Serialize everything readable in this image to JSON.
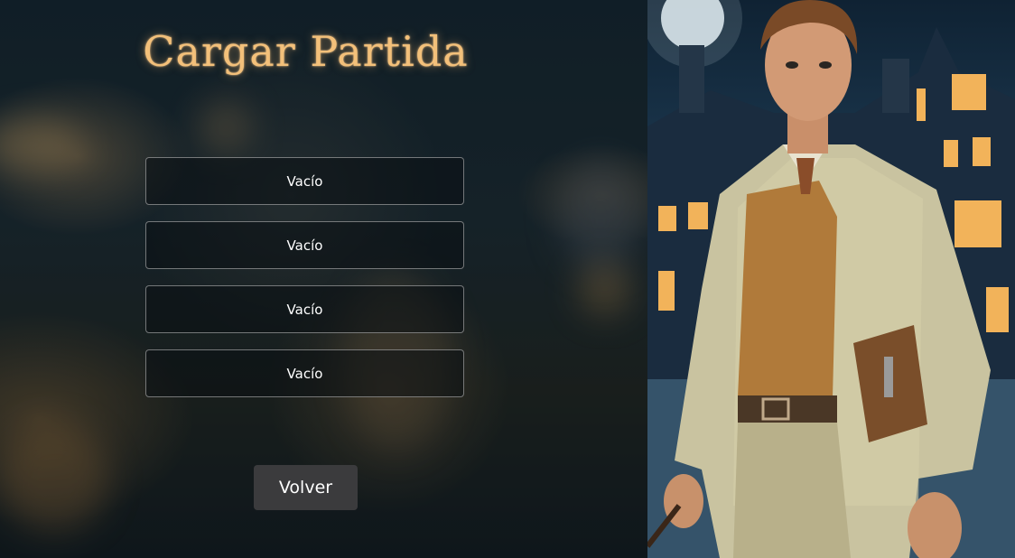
{
  "screen": {
    "title": "Cargar Partida"
  },
  "save_slots": [
    {
      "label": "Vacío"
    },
    {
      "label": "Vacío"
    },
    {
      "label": "Vacío"
    },
    {
      "label": "Vacío"
    }
  ],
  "actions": {
    "back_label": "Volver"
  },
  "colors": {
    "title": "#f3c07a",
    "slot_border": "#c8c8c8",
    "back_button_bg": "#3b3b3d"
  },
  "art": {
    "left_background": "blurred-night-mansion-scene",
    "right_panel": "young-man-in-trench-coat-holding-book-before-mansion"
  }
}
